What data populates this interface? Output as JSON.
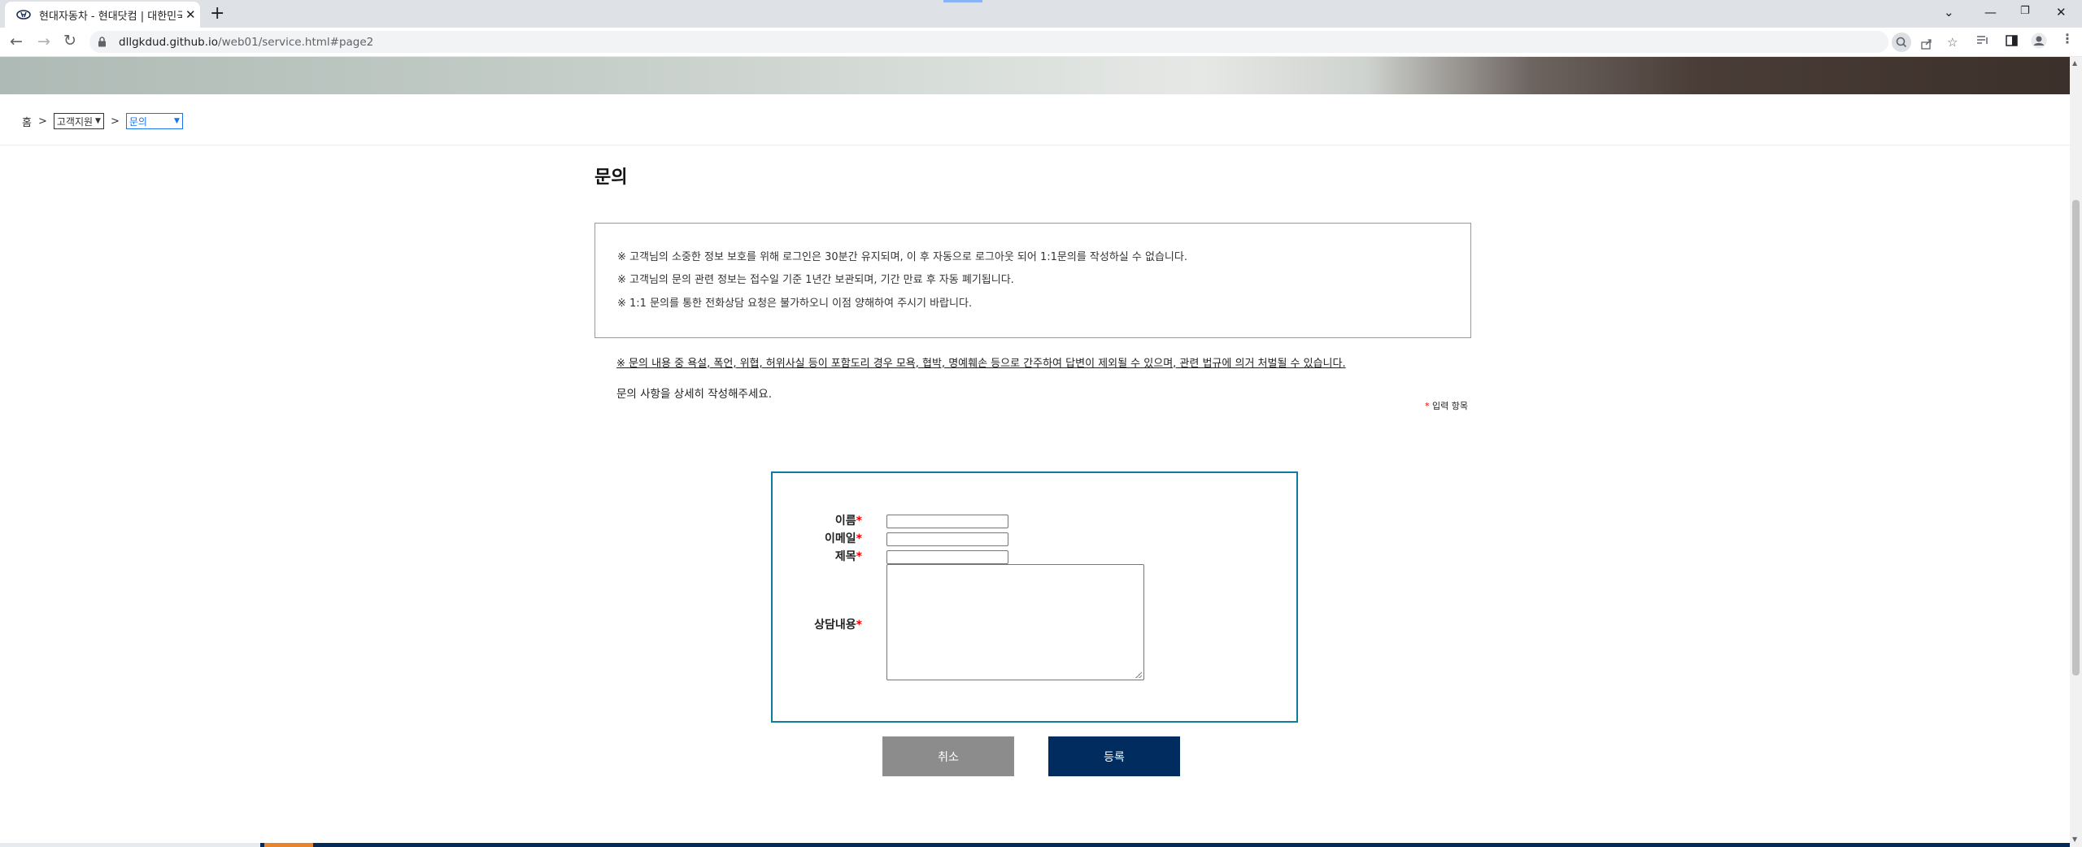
{
  "browser": {
    "tab_title": "현대자동차 - 현대닷컴 | 대한민국",
    "url_domain": "dllgkdud.github.io",
    "url_path": "/web01/service.html#page2"
  },
  "breadcrumb": {
    "home": "홈",
    "sep": ">",
    "category_select": "고객지원",
    "page_select": "문의"
  },
  "page": {
    "title": "문의",
    "notices": [
      "※ 고객님의 소중한 정보 보호를 위해 로그인은 30분간 유지되며, 이 후 자동으로 로그아웃 되어 1:1문의를 작성하실 수 없습니다.",
      "※ 고객님의 문의 관련 정보는 접수일 기준 1년간 보관되며, 기간 만료 후 자동 폐기됩니다.",
      "※ 1:1 문의를 통한 전화상담 요청은 불가하오니 이점 양해하여 주시기 바랍니다."
    ],
    "warning": "※ 문의 내용 중 욕설, 폭언, 위협, 허위사실 등이 포함도리 경우 모욕, 협박, 명예훼손 등으로 간주하여 답변이 제외될 수 있으며, 관련 법규에 의거 처벌될 수 있습니다.",
    "instruction": "문의 사항을 상세히 작성해주세요.",
    "required_star": "*",
    "required_note": "입력 항목"
  },
  "form": {
    "name_label": "이름",
    "email_label": "이메일",
    "subject_label": "제목",
    "content_label": "상담내용",
    "required_mark": "*",
    "name_value": "",
    "email_value": "",
    "subject_value": "",
    "content_value": ""
  },
  "buttons": {
    "cancel": "취소",
    "submit": "등록"
  },
  "colors": {
    "form_border": "#127a9e",
    "submit_bg": "#002c5f",
    "cancel_bg": "#8c8c8c",
    "required": "#e00000"
  }
}
